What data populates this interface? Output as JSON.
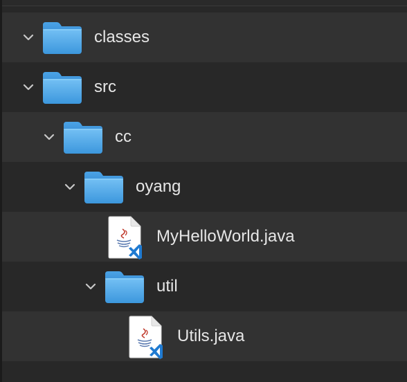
{
  "tree": {
    "items": [
      {
        "label": "classes",
        "kind": "folder",
        "expanded": true,
        "depth": 0
      },
      {
        "label": "src",
        "kind": "folder",
        "expanded": true,
        "depth": 0
      },
      {
        "label": "cc",
        "kind": "folder",
        "expanded": true,
        "depth": 1
      },
      {
        "label": "oyang",
        "kind": "folder",
        "expanded": true,
        "depth": 2
      },
      {
        "label": "MyHelloWorld.java",
        "kind": "file",
        "icon": "java-file-icon",
        "depth": 3
      },
      {
        "label": "util",
        "kind": "folder",
        "expanded": true,
        "depth": 2
      },
      {
        "label": "Utils.java",
        "kind": "file",
        "icon": "java-file-icon",
        "depth": 3
      }
    ]
  },
  "colors": {
    "folder_top": "#69b9f2",
    "folder_bottom": "#3a94db",
    "row_alt": "#323232",
    "row_base": "#282828",
    "text": "#e6e6e6",
    "vscode_badge": "#1f7ad1",
    "java_red": "#c0392b"
  }
}
